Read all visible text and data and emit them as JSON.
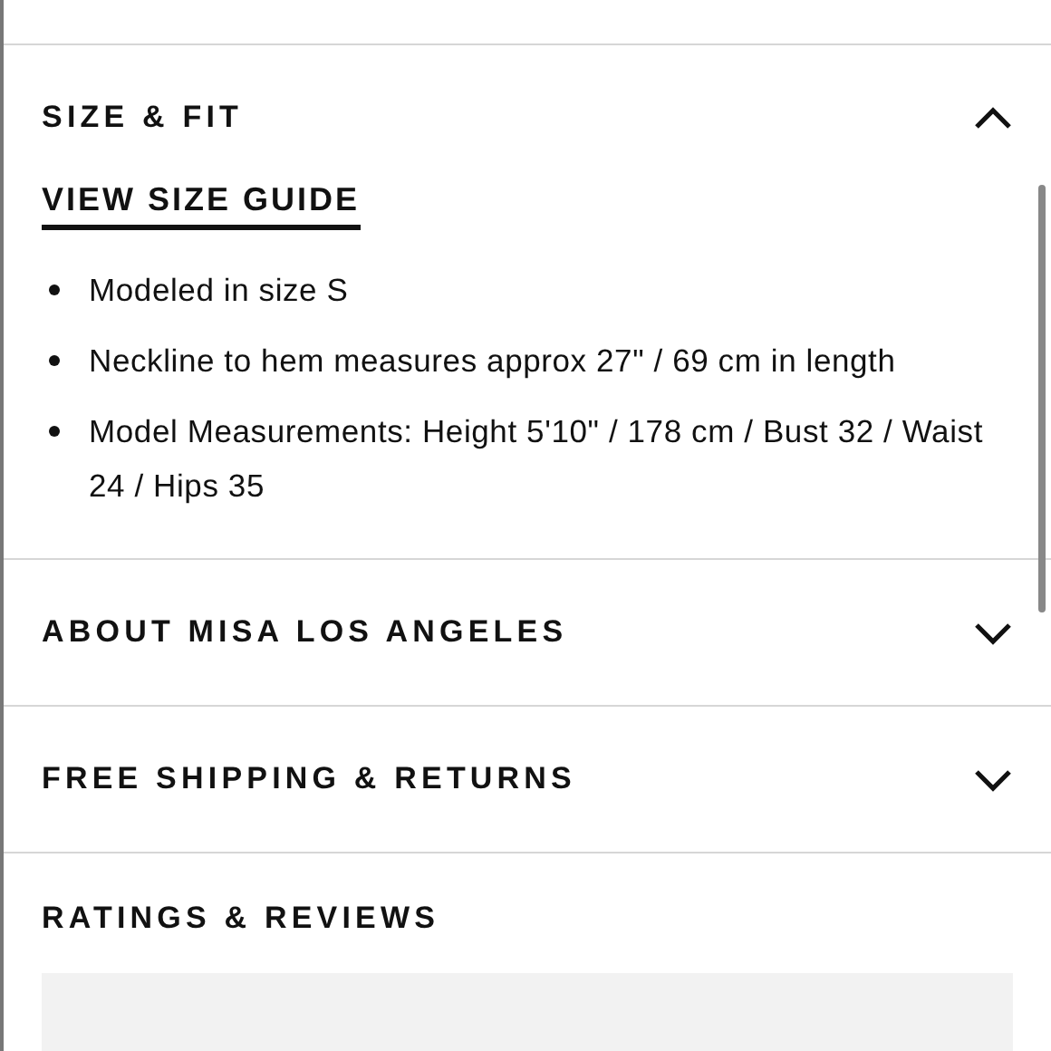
{
  "sections": [
    {
      "title": "SIZE & FIT",
      "expanded": true,
      "link": "VIEW SIZE GUIDE",
      "bullets": [
        "Modeled in size S",
        "Neckline to hem measures approx 27\" / 69 cm in length",
        "Model Measurements: Height 5'10\" / 178 cm / Bust 32 / Waist 24 / Hips 35"
      ]
    },
    {
      "title": "ABOUT MISA LOS ANGELES",
      "expanded": false
    },
    {
      "title": "FREE SHIPPING & RETURNS",
      "expanded": false
    }
  ],
  "ratings": {
    "title": "RATINGS & REVIEWS"
  }
}
